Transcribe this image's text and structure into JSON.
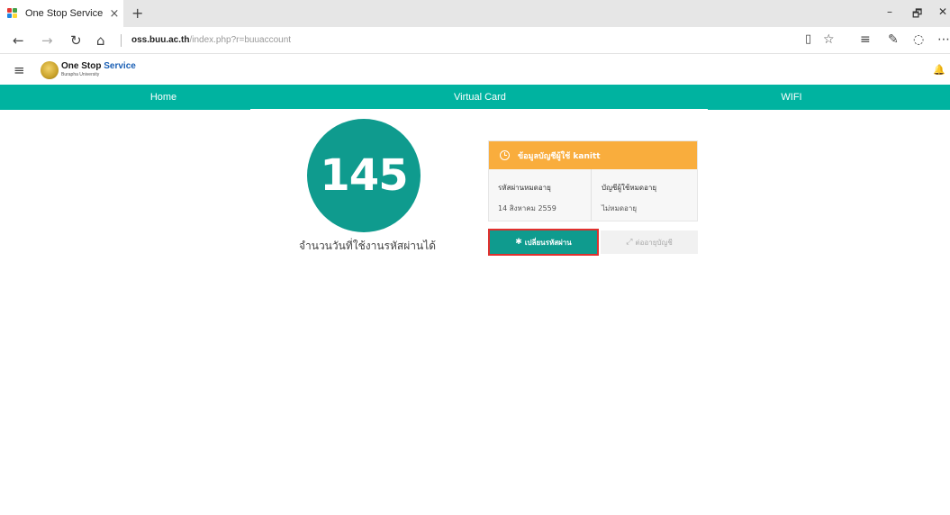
{
  "browser": {
    "tab_title": "One Stop Service",
    "tab_close": "×",
    "new_tab": "+",
    "address_domain": "oss.buu.ac.th",
    "address_path": "/index.php?r=buuaccount",
    "window_controls": {
      "minimize": "–",
      "restore": "🗗",
      "close": "✕"
    }
  },
  "app": {
    "logo_title_main": "One Stop",
    "logo_title_accent": " Service",
    "logo_subtitle": "Burapha University"
  },
  "nav": {
    "items": [
      {
        "label": "Home"
      },
      {
        "label": "Virtual Card"
      },
      {
        "label": "WIFI"
      }
    ]
  },
  "counter": {
    "value": "145",
    "label": "จำนวนวันที่ใช้งานรหัสผ่านได้"
  },
  "account": {
    "header": "ข้อมูลบัญชีผู้ใช้ kanitt",
    "password_expiry_label": "รหัสผ่านหมดอายุ",
    "password_expiry_value": "14 สิงหาคม 2559",
    "account_expiry_label": "บัญชีผู้ใช้หมดอายุ",
    "account_expiry_value": "ไม่หมดอายุ"
  },
  "buttons": {
    "change_password": "เปลี่ยนรหัสผ่าน",
    "extend_account": "ต่ออายุบัญชี"
  },
  "colors": {
    "teal": "#00b3a0",
    "teal_dark": "#0f9b8e",
    "orange": "#f9ad3d",
    "highlight_red": "#e0302e"
  }
}
